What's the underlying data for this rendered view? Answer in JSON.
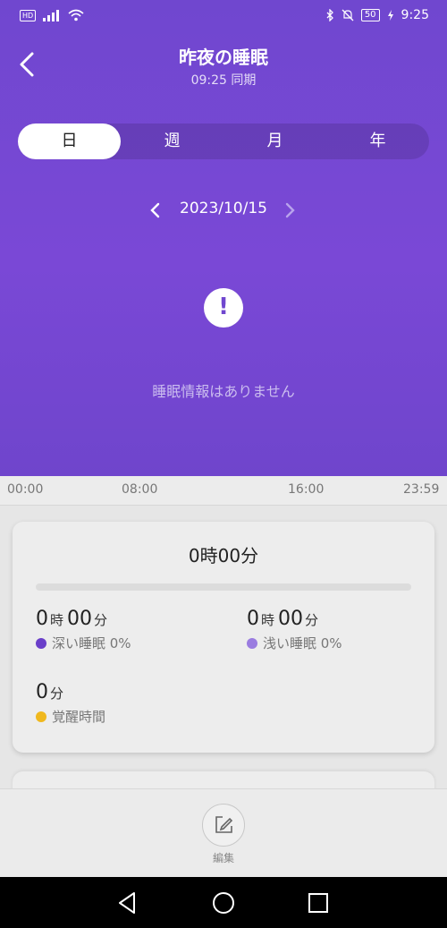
{
  "status_bar": {
    "hd_badge": "HD",
    "battery": "50",
    "time": "9:25",
    "icons": [
      "signal-icon",
      "wifi-icon",
      "bluetooth-icon",
      "mute-icon",
      "charging-icon"
    ]
  },
  "header": {
    "title": "昨夜の睡眠",
    "subtitle": "09:25 同期"
  },
  "tabs": [
    {
      "label": "日",
      "active": true
    },
    {
      "label": "週",
      "active": false
    },
    {
      "label": "月",
      "active": false
    },
    {
      "label": "年",
      "active": false
    }
  ],
  "date_nav": {
    "date": "2023/10/15"
  },
  "empty_state": {
    "icon": "!",
    "message": "睡眠情報はありません"
  },
  "timeline": {
    "ticks": [
      "00:00",
      "08:00",
      "16:00",
      "23:59"
    ]
  },
  "summary": {
    "total": "0時00分",
    "deep": {
      "hours": "0",
      "hours_unit": "時",
      "minutes": "00",
      "minutes_unit": "分",
      "label": "深い睡眠 0%",
      "color": "#6a3fc9"
    },
    "light": {
      "hours": "0",
      "hours_unit": "時",
      "minutes": "00",
      "minutes_unit": "分",
      "label": "浅い睡眠 0%",
      "color": "#9a7ce0"
    },
    "awake": {
      "minutes": "0",
      "minutes_unit": "分",
      "label": "覚醒時間",
      "color": "#f0b81e"
    }
  },
  "bottom": {
    "edit_label": "編集"
  },
  "colors": {
    "hero": "#7047cf",
    "accent": "#7a48d6"
  }
}
